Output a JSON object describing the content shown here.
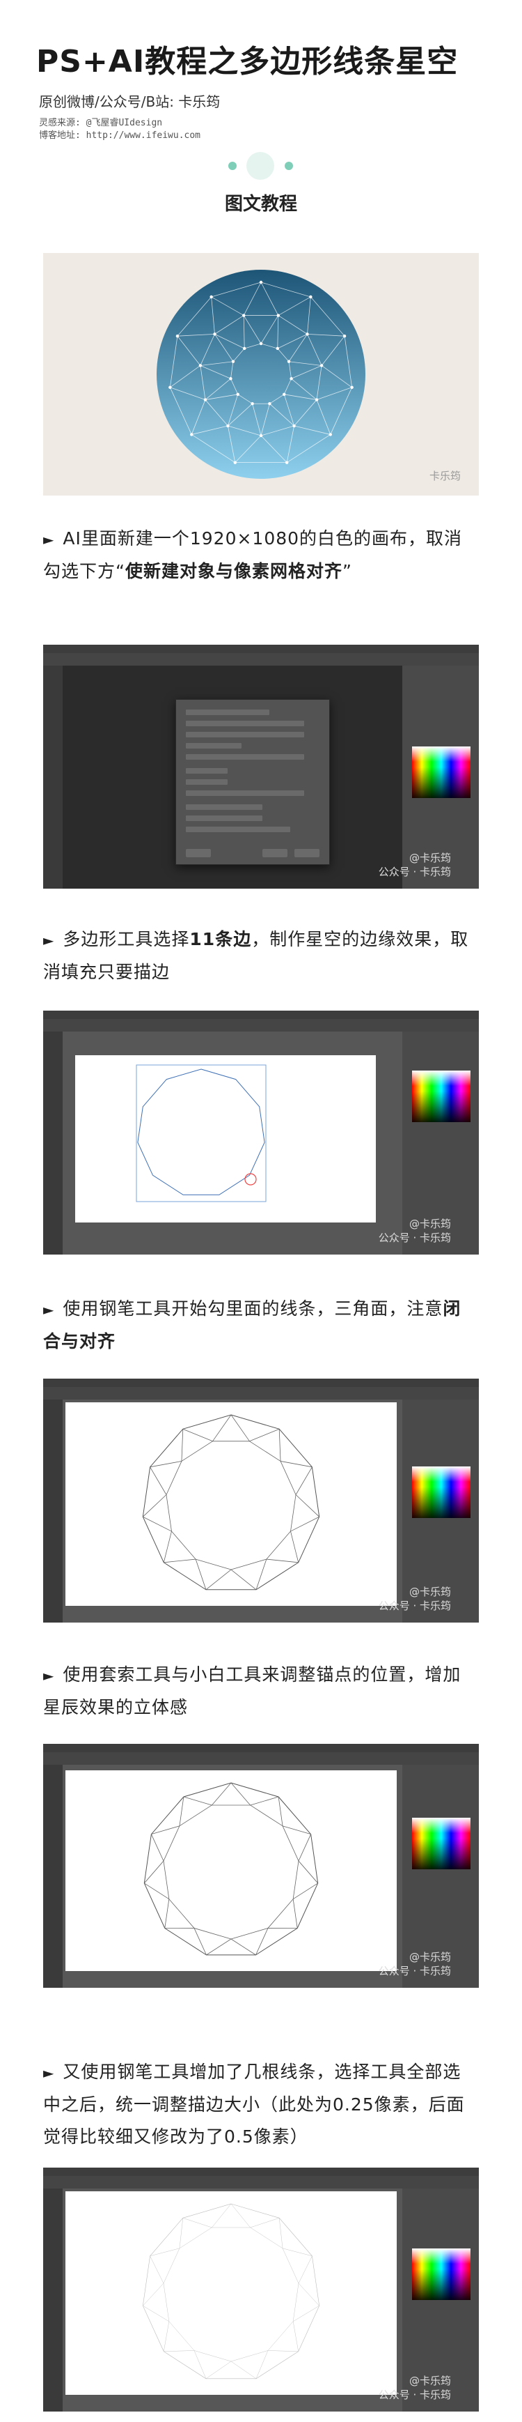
{
  "header": {
    "title": "PS+AI教程之多边形线条星空",
    "subtitle": "原创微博/公众号/B站: 卡乐筠",
    "source_line": "灵感来源: @飞屋睿UIdesign",
    "blog_line": "博客地址:  http://www.ifeiwu.com"
  },
  "section_title": "图文教程",
  "hero": {
    "watermark": "卡乐筠",
    "colors": {
      "top": "#1d5577",
      "bottom": "#8ed0ee",
      "background": "#efebe4"
    }
  },
  "steps": [
    {
      "pre": "AI里面新建一个1920×1080的白色的画布，取消勾选下方“",
      "bold": "使新建对象与像素网格对齐",
      "post": "”"
    },
    {
      "pre": "多边形工具选择",
      "bold": "11条边",
      "post": "，制作星空的边缘效果，取消填充只要描边"
    },
    {
      "pre": "使用钢笔工具开始勾里面的线条，三角面，注意",
      "bold": "闭合与对齐",
      "post": ""
    },
    {
      "pre": "使用套索工具与小白工具来调整锚点的位置，增加星辰效果的立体感",
      "bold": "",
      "post": ""
    },
    {
      "pre": "又使用钢笔工具增加了几根线条，选择工具全部选中之后，统一调整描边大小（此处为0.25像素，后面觉得比较细又修改为了0.5像素）",
      "bold": "",
      "post": ""
    }
  ],
  "screenshot_watermark": {
    "line1": "@卡乐筠",
    "line2": "公众号 · 卡乐筠"
  },
  "step_marker": "►"
}
